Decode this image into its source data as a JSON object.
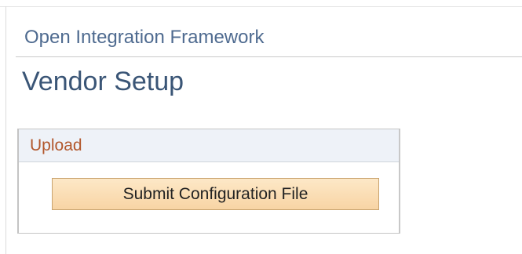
{
  "header": {
    "app_title": "Open Integration Framework",
    "page_title": "Vendor Setup"
  },
  "upload_section": {
    "title": "Upload",
    "submit_button_label": "Submit Configuration File"
  },
  "colors": {
    "app_title": "#4f6b90",
    "page_title": "#3a5576",
    "section_title": "#b2572c",
    "section_header_bg": "#eef2f8",
    "button_bg": "#f8d4a4",
    "button_border": "#c9a36e"
  }
}
